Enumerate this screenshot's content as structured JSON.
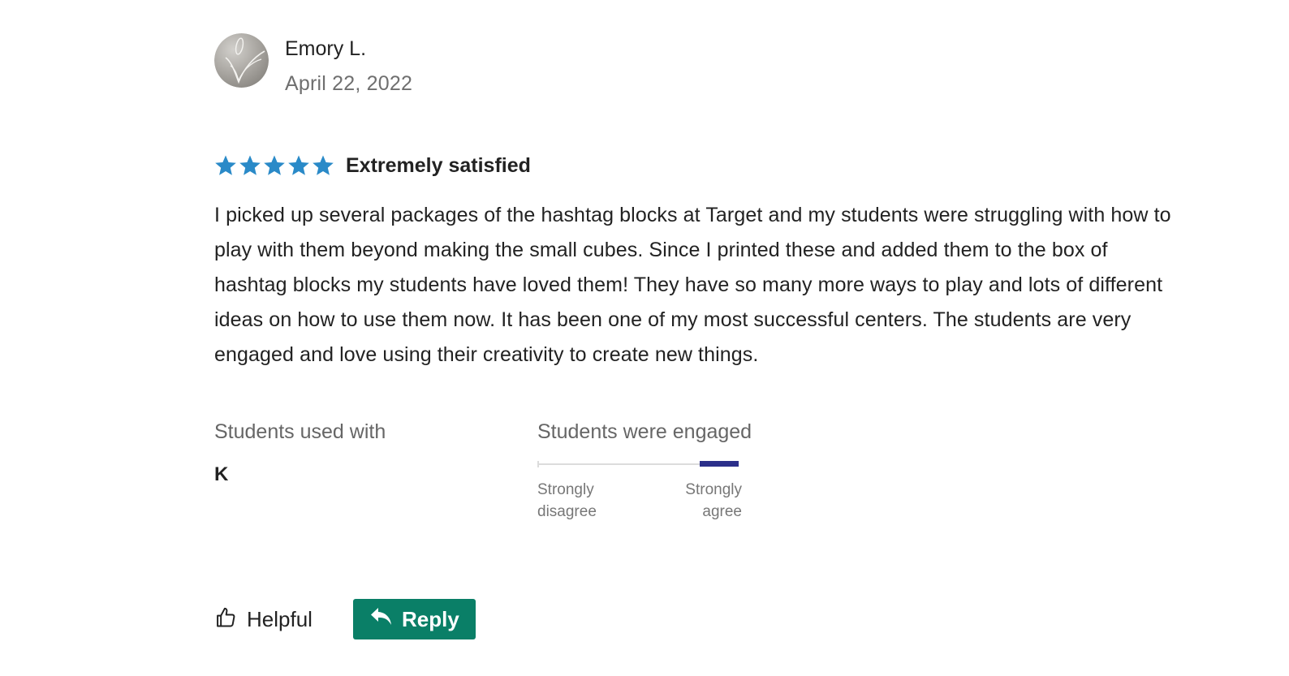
{
  "review": {
    "author_name": "Emory L.",
    "date": "April 22, 2022",
    "rating": 5,
    "rating_max": 5,
    "rating_label": "Extremely satisfied",
    "star_color": "#2a8ac8",
    "body": "I picked up several packages of the hashtag blocks at Target and my students were struggling with how to play with them beyond making the small cubes. Since I printed these and added them to the box of hashtag blocks my students have loved them! They have so many more ways to play and lots of different ideas on how to use them now. It has been one of my most successful centers. The students are very engaged and love using their creativity to create new things."
  },
  "attributes": {
    "grades": {
      "heading": "Students used with",
      "value": "K"
    },
    "engagement": {
      "heading": "Students were engaged",
      "level": 1.0,
      "left_label_line1": "Strongly",
      "left_label_line2": "disagree",
      "right_label_line1": "Strongly",
      "right_label_line2": "agree",
      "fill_color": "#2b2f8a"
    }
  },
  "actions": {
    "helpful_label": "Helpful",
    "reply_label": "Reply",
    "reply_color": "#0a7f67"
  }
}
